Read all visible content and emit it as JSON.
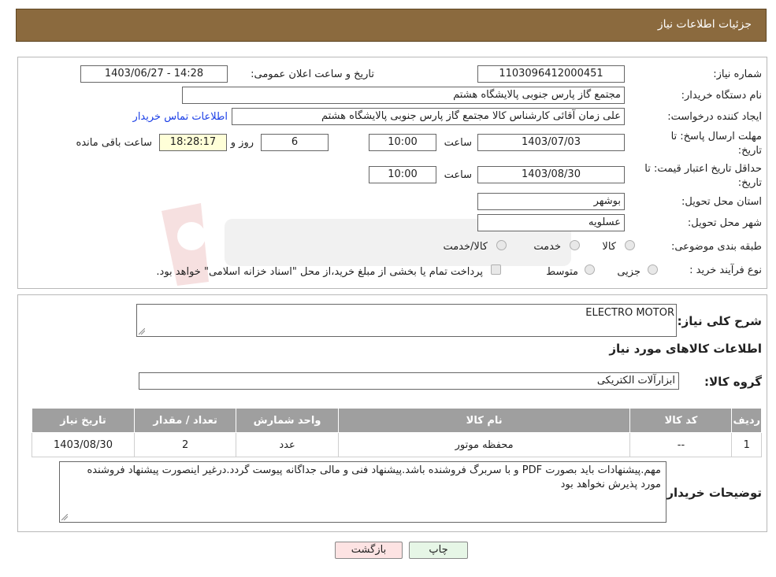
{
  "header": {
    "title": "جزئیات اطلاعات نیاز"
  },
  "info": {
    "need_number_label": "شماره نیاز:",
    "need_number": "1103096412000451",
    "announce_label": "تاریخ و ساعت اعلان عمومی:",
    "announce_value": "1403/06/27 - 14:28",
    "buyer_org_label": "نام دستگاه خریدار:",
    "buyer_org": "مجتمع گاز پارس جنوبی  پالایشگاه هشتم",
    "creator_label": "ایجاد کننده درخواست:",
    "creator": "علی زمان آقائی کارشناس کالا مجتمع گاز پارس جنوبی  پالایشگاه هشتم",
    "contact_link": "اطلاعات تماس خریدار",
    "deadline_label_1": "مهلت ارسال پاسخ: تا",
    "deadline_label_2": "تاریخ:",
    "deadline_date": "1403/07/03",
    "time_label": "ساعت",
    "deadline_time": "10:00",
    "days_value": "6",
    "days_label": "روز و",
    "remaining_time": "18:28:17",
    "remaining_label": "ساعت باقی مانده",
    "validity_label_1": "حداقل تاریخ اعتبار قیمت: تا",
    "validity_label_2": "تاریخ:",
    "validity_date": "1403/08/30",
    "validity_time": "10:00",
    "province_label": "استان محل تحویل:",
    "province": "بوشهر",
    "city_label": "شهر محل تحویل:",
    "city": "عسلویه",
    "category_label": "طبقه بندی موضوعی:",
    "category_options": [
      "کالا",
      "خدمت",
      "کالا/خدمت"
    ],
    "process_label": "نوع فرآیند خرید :",
    "process_options": [
      "جزیی",
      "متوسط"
    ],
    "process_note": "پرداخت تمام یا بخشی از مبلغ خرید،از محل \"اسناد خزانه اسلامی\" خواهد بود."
  },
  "details": {
    "description_label": "شرح کلی نیاز:",
    "description": "ELECTRO MOTOR",
    "goods_info_title": "اطلاعات کالاهای مورد نیاز",
    "group_label": "گروه کالا:",
    "group_value": "ابزارآلات الکتریکی",
    "table": {
      "headers": [
        "ردیف",
        "کد کالا",
        "نام کالا",
        "واحد شمارش",
        "تعداد / مقدار",
        "تاریخ نیاز"
      ],
      "rows": [
        [
          "1",
          "--",
          "محفظه موتور",
          "عدد",
          "2",
          "1403/08/30"
        ]
      ]
    },
    "buyer_notes_label": "توضیحات خریدار:",
    "buyer_notes": "مهم.پیشنهادات باید بصورت PDF و با سربرگ فروشنده باشد.پیشنهاد فنی و مالی جداگانه پیوست گردد.درغیر اینصورت پیشنهاد فروشنده مورد پذیرش نخواهد بود"
  },
  "buttons": {
    "print": "چاپ",
    "back": "بازگشت"
  },
  "colors": {
    "header_bg": "#8b6a3e",
    "table_header_bg": "#9f9f9f",
    "back_button_bg": "#fde3e3",
    "print_button_bg": "#e6f6e6",
    "link": "#1a3ee6"
  }
}
